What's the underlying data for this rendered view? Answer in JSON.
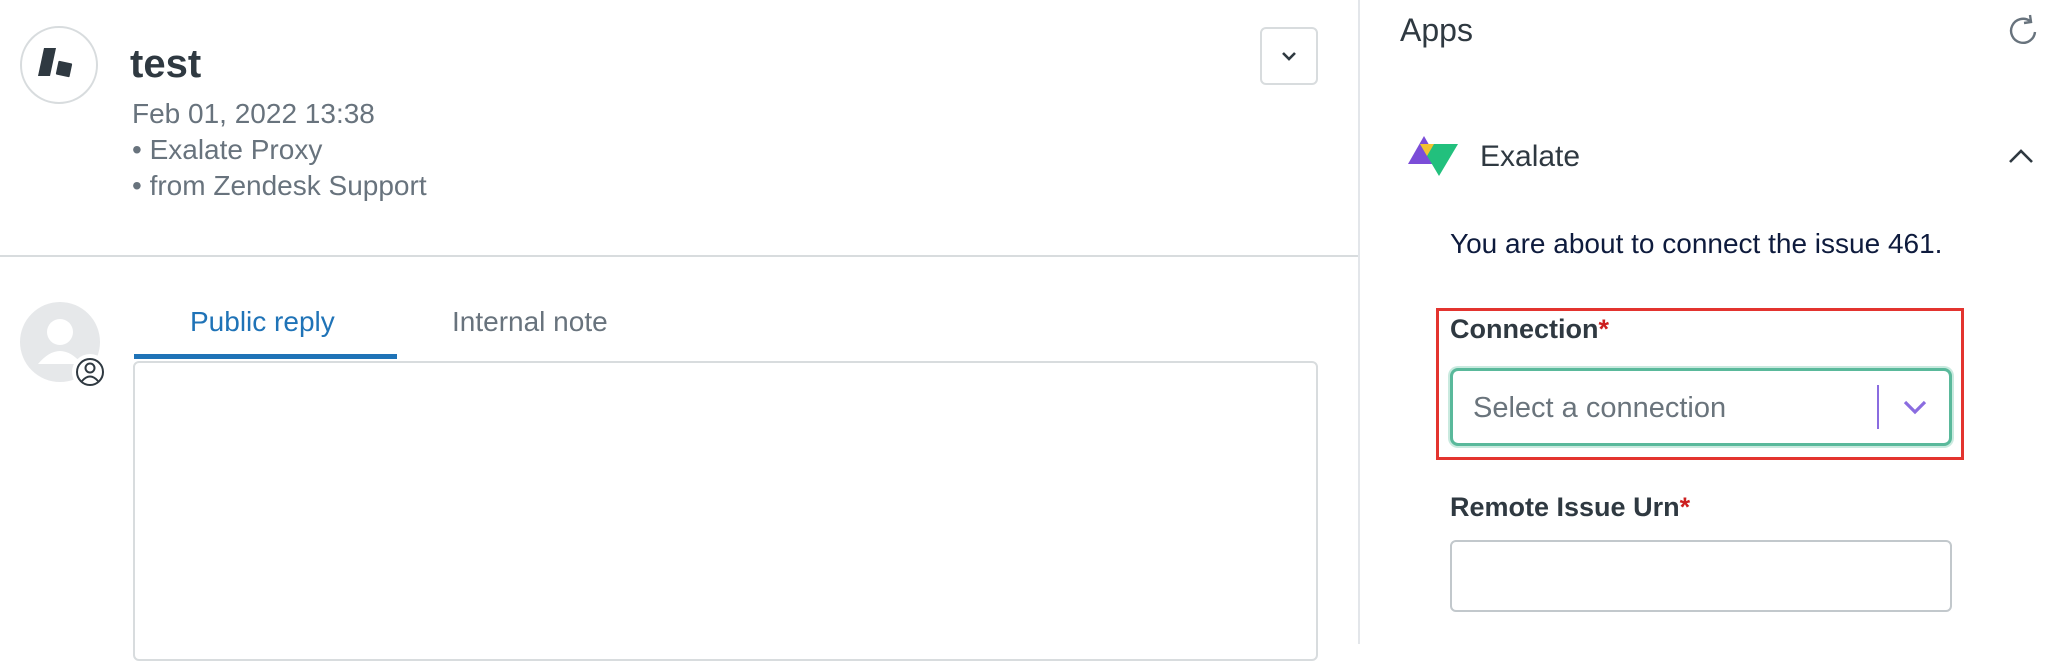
{
  "ticket": {
    "title": "test",
    "date": "Feb 01, 2022 13:38",
    "via": "• Exalate Proxy",
    "source": "• from Zendesk Support",
    "icons": {
      "org": "zendesk-logo-icon",
      "more": "chevron-down-icon"
    }
  },
  "composer": {
    "tabs": [
      {
        "label": "Public reply",
        "active": true
      },
      {
        "label": "Internal note",
        "active": false
      }
    ],
    "reply_value": ""
  },
  "apps": {
    "heading": "Apps",
    "app_name": "Exalate",
    "message": "You are about to connect the issue 461.",
    "connection": {
      "label": "Connection",
      "required_mark": "*",
      "placeholder": "Select a connection"
    },
    "remote_urn": {
      "label": "Remote Issue Urn",
      "required_mark": "*",
      "value": ""
    }
  },
  "colors": {
    "tab_active": "#1f73b7",
    "required": "#cc1f1f",
    "select_border": "#5ab99b",
    "highlight": "#e3342f"
  }
}
